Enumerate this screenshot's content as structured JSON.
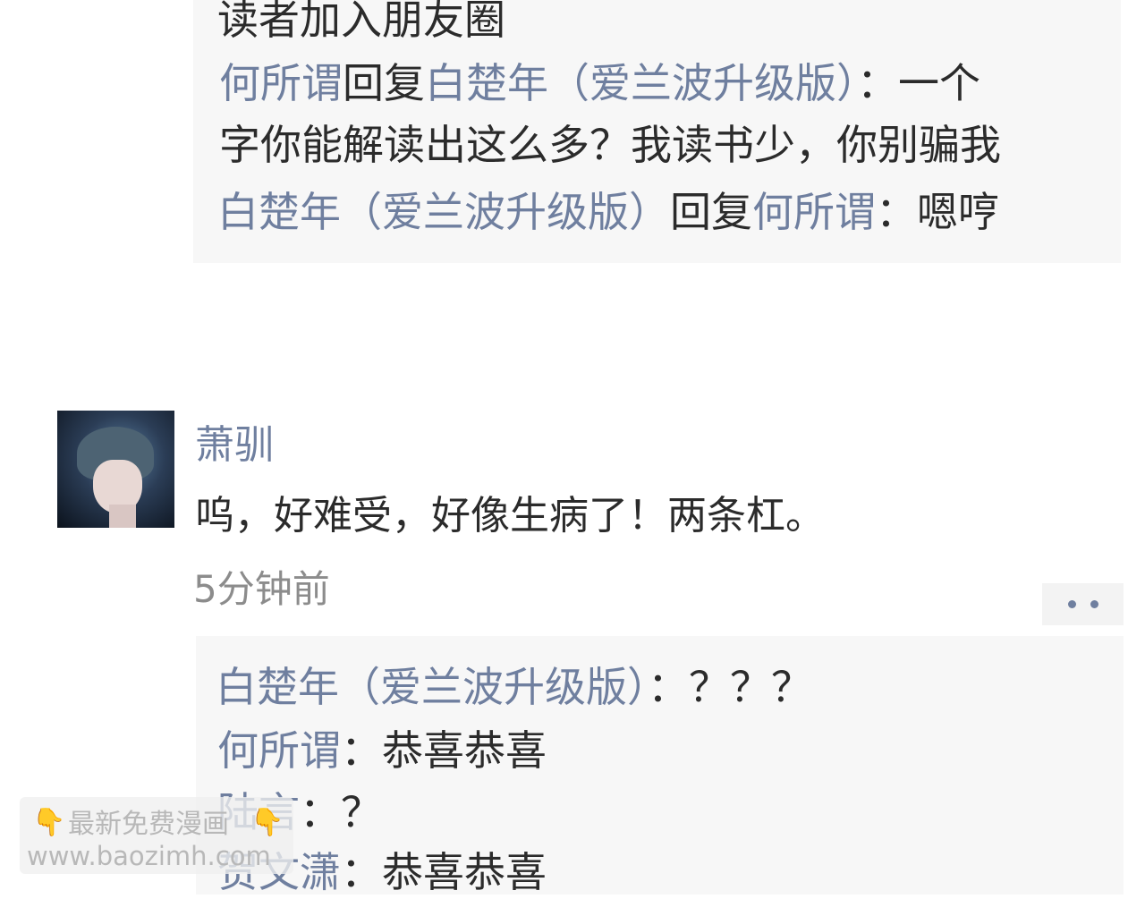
{
  "top_block": {
    "line0": "读者加入朋友圈",
    "line1": {
      "name": "何所谓",
      "reply": "回复",
      "target": "白楚年（爱兰波升级版）",
      "sep": "：",
      "text": "一个"
    },
    "line2": "字你能解读出这么多？我读书少，你别骗我",
    "line3": {
      "name": "白楚年（爱兰波升级版）",
      "reply": "回复",
      "target": "何所谓",
      "sep": "：",
      "text": "嗯哼"
    }
  },
  "post": {
    "avatar": "avatar-image",
    "author": "萧驯",
    "text": "呜，好难受，好像生病了！两条杠。",
    "time": "5分钟前",
    "more_icon": "more-dots-icon"
  },
  "comments": [
    {
      "name": "白楚年（爱兰波升级版）",
      "sep": "：",
      "text": "？？？"
    },
    {
      "name": "何所谓",
      "sep": "：",
      "text": "恭喜恭喜"
    },
    {
      "name": "陆言",
      "sep": "：",
      "text": "？"
    },
    {
      "name": "贺文潇",
      "sep": "：",
      "text": "恭喜恭喜"
    }
  ],
  "watermark": {
    "line1": "最新免费漫画",
    "line2": "www.baozimh.com",
    "icon": "pointing-down-hand-icon"
  }
}
